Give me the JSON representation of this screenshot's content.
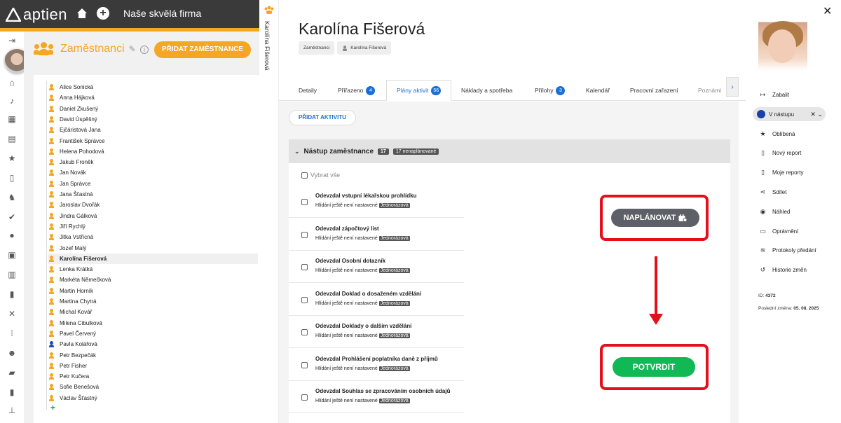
{
  "app": {
    "logo_text": "aptien",
    "company": "Naše skvělá firma"
  },
  "left_panel": {
    "title": "Zaměstnanci",
    "add_button": "PŘIDAT ZAMĚSTNANCE",
    "employees": [
      {
        "name": "Alice Sonická",
        "color": "orange"
      },
      {
        "name": "Anna Hájková",
        "color": "orange"
      },
      {
        "name": "Daniel Zkušený",
        "color": "orange"
      },
      {
        "name": "David Úspěšný",
        "color": "orange"
      },
      {
        "name": "Ejčáristová Jana",
        "color": "orange"
      },
      {
        "name": "František Správce",
        "color": "orange"
      },
      {
        "name": "Helena Pohodová",
        "color": "orange"
      },
      {
        "name": "Jakub Froněk",
        "color": "orange"
      },
      {
        "name": "Jan Novák",
        "color": "orange"
      },
      {
        "name": "Jan Správce",
        "color": "orange"
      },
      {
        "name": "Jana Šťastná",
        "color": "orange"
      },
      {
        "name": "Jaroslav Dvořák",
        "color": "orange"
      },
      {
        "name": "Jindra Gálková",
        "color": "orange"
      },
      {
        "name": "Jiří Rychlý",
        "color": "orange"
      },
      {
        "name": "Jitka Vstřícná",
        "color": "orange"
      },
      {
        "name": "Jozef Malý",
        "color": "orange"
      },
      {
        "name": "Karolína Fišerová",
        "color": "orange",
        "selected": true
      },
      {
        "name": "Lenka Krátká",
        "color": "orange"
      },
      {
        "name": "Markéta Němečková",
        "color": "orange"
      },
      {
        "name": "Martin Horník",
        "color": "orange"
      },
      {
        "name": "Martina Chytrá",
        "color": "orange"
      },
      {
        "name": "Michal Kovář",
        "color": "orange"
      },
      {
        "name": "Milena Cibulková",
        "color": "orange"
      },
      {
        "name": "Pavel Červený",
        "color": "orange"
      },
      {
        "name": "Pavla Kolářová",
        "color": "blue"
      },
      {
        "name": "Petr Bezpečák",
        "color": "orange"
      },
      {
        "name": "Petr Fisher",
        "color": "orange"
      },
      {
        "name": "Petr Kučera",
        "color": "orange"
      },
      {
        "name": "Sofie Benešová",
        "color": "orange"
      },
      {
        "name": "Václav Šťastný",
        "color": "orange"
      }
    ]
  },
  "vertical_tab": "Karolína Fišerová",
  "main": {
    "person_name": "Karolína Fišerová",
    "breadcrumbs": [
      "Zaměstnanci",
      "Karolína Fišerová"
    ],
    "tabs": [
      {
        "label": "Detaily"
      },
      {
        "label": "Přiřazeno",
        "badge": "4"
      },
      {
        "label": "Plány aktivit",
        "badge": "56",
        "active": true
      },
      {
        "label": "Náklady a spotřeba"
      },
      {
        "label": "Přílohy",
        "badge": "3"
      },
      {
        "label": "Kalendář"
      },
      {
        "label": "Pracovní zařazení"
      },
      {
        "label": "Poznámi"
      }
    ],
    "add_activity": "PŘIDAT AKTIVITU",
    "section_title": "Nástup zaměstnance",
    "section_count": "17",
    "section_unplanned": "17 nenaplánované",
    "select_all": "Vybrat vše",
    "activities": [
      {
        "title": "Odevzdal vstupní lékařskou prohlídku",
        "sub": "Hlídání ještě není nastavené",
        "tag": "Jednorázová"
      },
      {
        "title": "Odevzdal zápočtový list",
        "sub": "Hlídání ještě není nastavené",
        "tag": "Jednorázová"
      },
      {
        "title": "Odevzdal Osobní dotazník",
        "sub": "Hlídání ještě není nastavené",
        "tag": "Jednorázová"
      },
      {
        "title": "Odevzdal Doklad o dosaženém vzdělání",
        "sub": "Hlídání ještě není nastavené",
        "tag": "Jednorázová"
      },
      {
        "title": "Odevzdal Doklady o dalším vzdělání",
        "sub": "Hlídání ještě není nastavené",
        "tag": "Jednorázová"
      },
      {
        "title": "Odevzdal Prohlášení poplatníka daně z příjmů",
        "sub": "Hlídání ještě není nastavené",
        "tag": "Jednorázová"
      },
      {
        "title": "Odevzdal Souhlas se zpracováním osobních údajů",
        "sub": "Hlídání ještě není nastavené",
        "tag": "Jednorázová"
      }
    ],
    "plan_button": "NAPLÁNOVAT",
    "confirm_button": "POTVRDIT"
  },
  "right_panel": {
    "collapse": "Zabalit",
    "status": "V nástupu",
    "actions": [
      "Oblíbená",
      "Nový report",
      "Moje reporty",
      "Sdílet",
      "Náhled",
      "Oprávnění",
      "Protokoly předání",
      "Historie změn"
    ],
    "id_label": "ID:",
    "id_value": "4372",
    "last_change_label": "Poslední změna:",
    "last_change_value": "05. 08. 2025"
  }
}
